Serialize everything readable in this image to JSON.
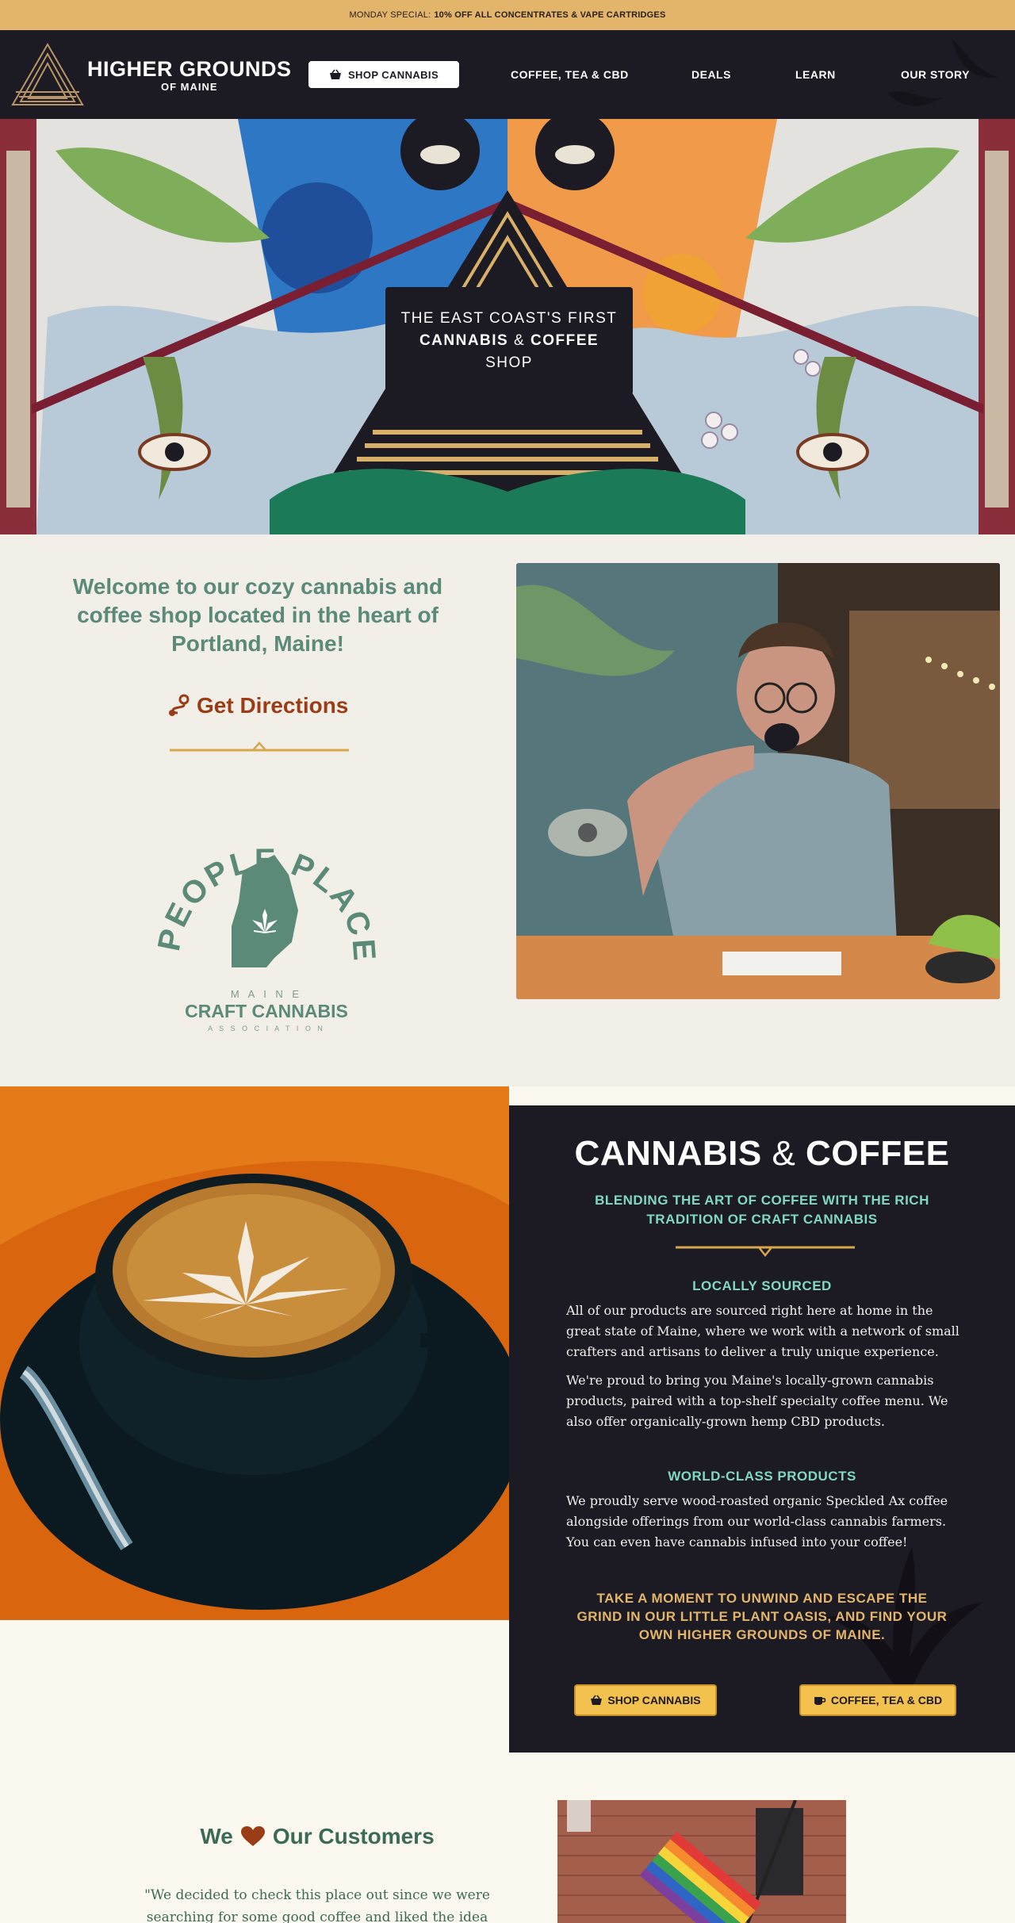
{
  "announcement": {
    "prefix": "MONDAY SPECIAL:",
    "highlight": "10% OFF ALL CONCENTRATES & VAPE CARTRIDGES"
  },
  "header": {
    "logo_title": "HIGHER GROUNDS",
    "logo_subtitle": "OF MAINE",
    "shop_button": "SHOP CANNABIS",
    "nav": [
      "COFFEE, TEA & CBD",
      "DEALS",
      "LEARN",
      "OUR STORY"
    ]
  },
  "hero": {
    "line1": "THE EAST COAST'S FIRST",
    "line2_a": "CANNABIS",
    "line2_amp": "&",
    "line2_b": "COFFEE",
    "line3": "SHOP"
  },
  "welcome": {
    "title": "Welcome to our cozy cannabis and coffee shop located in the heart of Portland, Maine!",
    "directions": "Get Directions",
    "badge_top": "PEOPLE PLACE PLANT",
    "badge_state": "M A I N E",
    "badge_name": "CRAFT CANNABIS",
    "badge_assoc": "A S S O C I A T I O N"
  },
  "cannabis_coffee": {
    "title_a": "CANNABIS",
    "title_amp": "&",
    "title_b": "COFFEE",
    "subtitle": "BLENDING THE ART OF COFFEE WITH THE RICH TRADITION OF CRAFT CANNABIS",
    "h1": "LOCALLY SOURCED",
    "p1": "All of our products are sourced right here at home in the great state of Maine, where we work with a network of small crafters and artisans to deliver a truly unique experience.",
    "p2": "We're proud to bring you Maine's locally-grown cannabis products, paired with a top-shelf specialty coffee menu. We also offer organically-grown hemp CBD products.",
    "h2": "WORLD-CLASS PRODUCTS",
    "p3": "We proudly serve wood-roasted organic Speckled Ax coffee alongside offerings from our world-class cannabis farmers. You can even have cannabis infused into your coffee!",
    "cta": "TAKE A MOMENT TO UNWIND AND ESCAPE THE GRIND IN OUR LITTLE PLANT OASIS, AND FIND YOUR OWN HIGHER GROUNDS OF MAINE.",
    "btn_shop": "SHOP CANNABIS",
    "btn_coffee": "COFFEE, TEA & CBD"
  },
  "customers": {
    "title_a": "We",
    "title_b": "Our Customers",
    "quote": "\"We decided to check this place out since we were searching for some good coffee and liked the idea"
  },
  "colors": {
    "announcement_bg": "#e3b56b",
    "dark": "#1c1a22",
    "teal": "#5b8a79",
    "mint": "#7fd8c2",
    "rust": "#9a3c16",
    "gold": "#e3b56b",
    "button_yellow": "#f2c14e"
  }
}
